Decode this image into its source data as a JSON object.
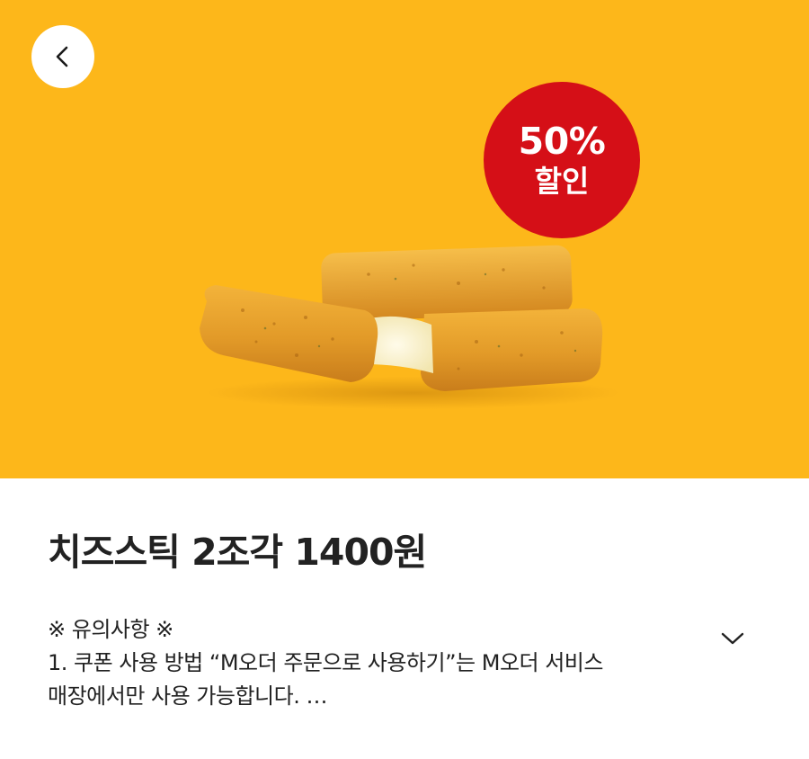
{
  "hero": {
    "background_color": "#FDB71A",
    "back_icon": "chevron-left-icon",
    "badge": {
      "percent": "50%",
      "label": "할인",
      "color": "#D50F17"
    },
    "product_image": "cheese-sticks-photo"
  },
  "coupon": {
    "title": "치즈스틱 2조각 1400원",
    "notice_header": "※ 유의사항 ※",
    "notice_line1": "1. 쿠폰 사용 방법 “M오더 주문으로 사용하기”는 M오더 서비스",
    "notice_line2": "매장에서만 사용 가능합니다. …",
    "expand_icon": "chevron-down-icon"
  }
}
